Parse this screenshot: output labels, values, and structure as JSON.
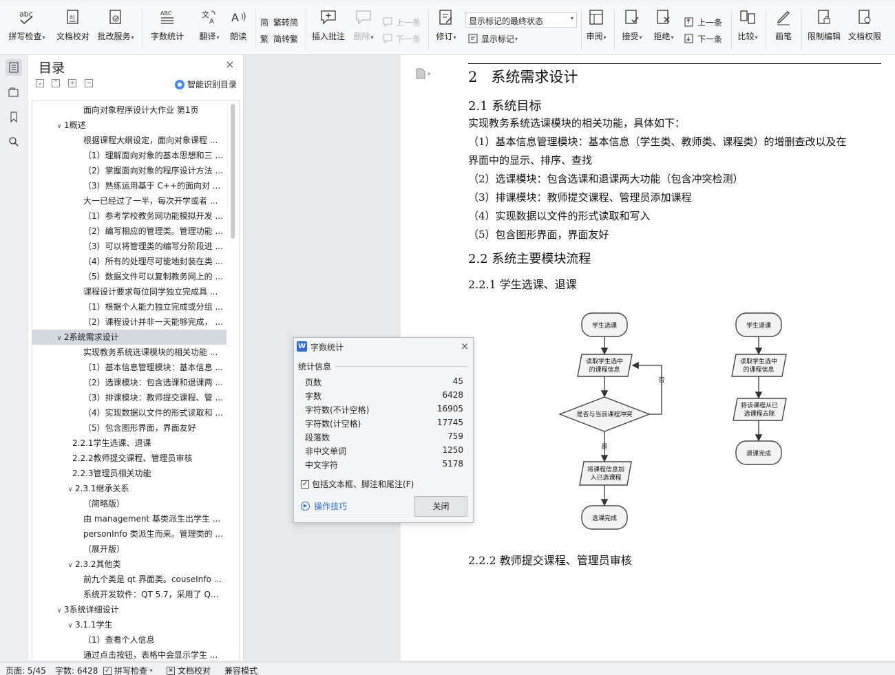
{
  "ribbon": {
    "spell_check": "拼写检查",
    "doc_proof": "文档校对",
    "batch_service": "批改服务",
    "word_count": "字数统计",
    "translate": "翻译",
    "read_aloud": "朗读",
    "trad_convert": "繁转简",
    "simp_convert": "简转繁",
    "insert_comment": "插入批注",
    "delete": "删除",
    "prev_comment": "上一条",
    "next_comment": "下一条",
    "revise": "修订",
    "markup_state": "显示标记的最终状态",
    "show_markup": "显示标记",
    "review": "审阅",
    "accept": "接受",
    "reject": "拒绝",
    "prev_change": "上一条",
    "next_change": "下一条",
    "compare": "比较",
    "pen": "画笔",
    "restrict_edit": "限制编辑",
    "doc_permission": "文档权限"
  },
  "toc": {
    "title": "目录",
    "smart_label": "智能识别目录",
    "items": [
      {
        "text": "面向对象程序设计大作业 第1页",
        "toggle": ""
      },
      {
        "text": "1概述",
        "toggle": "∨"
      },
      {
        "text": "根据课程大纲设定，面向对象课程 ...",
        "toggle": ""
      },
      {
        "text": "（1）理解面向对象的基本思想和三 ...",
        "toggle": ""
      },
      {
        "text": "（2）掌握面向对象的程序设计方法 ...",
        "toggle": ""
      },
      {
        "text": "（3）熟练运用基于 C++的面向对 ...",
        "toggle": ""
      },
      {
        "text": "大一已经过了一半，每次开学或者 ...",
        "toggle": ""
      },
      {
        "text": "（1）参考学校教务网功能模拟开发 ...",
        "toggle": ""
      },
      {
        "text": "（2）编写相应的管理类。管理功能 ...",
        "toggle": ""
      },
      {
        "text": "（3）可以将管理类的编写分阶段进 ...",
        "toggle": ""
      },
      {
        "text": "（4）所有的处理尽可能地封装在类 ...",
        "toggle": ""
      },
      {
        "text": "（5）数据文件可以复制教务网上的 ...",
        "toggle": ""
      },
      {
        "text": "课程设计要求每位同学独立完成具 ...",
        "toggle": ""
      },
      {
        "text": "（1）根据个人能力独立完成或分组 ...",
        "toggle": ""
      },
      {
        "text": "（2）课程设计并非一天能够完成， ...",
        "toggle": ""
      },
      {
        "text": "2系统需求设计",
        "toggle": "∨"
      },
      {
        "text": "实现教务系统选课模块的相关功能 ...",
        "toggle": ""
      },
      {
        "text": "（1）基本信息管理模块：基本信息 ...",
        "toggle": ""
      },
      {
        "text": "（2）选课模块：包含选课和退课两 ...",
        "toggle": ""
      },
      {
        "text": "（3）排课模块：教师提交课程、管 ...",
        "toggle": ""
      },
      {
        "text": "（4）实现数据以文件的形式读取和 ...",
        "toggle": ""
      },
      {
        "text": "（5）包含图形界面，界面友好",
        "toggle": ""
      },
      {
        "text": "2.2.1学生选课、退课",
        "toggle": ""
      },
      {
        "text": "2.2.2教师提交课程、管理员审核",
        "toggle": ""
      },
      {
        "text": "2.2.3管理员相关功能",
        "toggle": ""
      },
      {
        "text": "2.3.1继承关系",
        "toggle": "∨"
      },
      {
        "text": "（简略版）",
        "toggle": ""
      },
      {
        "text": "由 management 基类派生出学生 ...",
        "toggle": ""
      },
      {
        "text": "personInfo 类派生而来。管理类的 ...",
        "toggle": ""
      },
      {
        "text": "（展开版）",
        "toggle": ""
      },
      {
        "text": "2.3.2其他类",
        "toggle": "∨"
      },
      {
        "text": "前九个类是 qt 界面类。couseInfo ...",
        "toggle": ""
      },
      {
        "text": "系统开发软件：QT 5.7，采用了 Q...",
        "toggle": ""
      },
      {
        "text": "3系统详细设计",
        "toggle": "∨"
      },
      {
        "text": "3.1.1学生",
        "toggle": "∨"
      },
      {
        "text": "（1）查看个人信息",
        "toggle": ""
      },
      {
        "text": "通过点击按钮，表格中会显示学生 ...",
        "toggle": ""
      }
    ]
  },
  "doc": {
    "h1_num": "2",
    "h1": "系统需求设计",
    "h2_1": "2.1  系统目标",
    "p_intro": "实现教务系统选课模块的相关功能，具体如下：",
    "p1a": "（1）基本信息管理模块：基本信息（学生类、教师类、课程类）的增删查改以及在",
    "p1b": "界面中的显示、排序、查找",
    "p2": "（2）选课模块：包含选课和退课两大功能（包含冲突检测）",
    "p3": "（3）排课模块：教师提交课程、管理员添加课程",
    "p4": "（4）实现数据以文件的形式读取和写入",
    "p5": "（5）包含图形界面，界面友好",
    "h2_2": "2.2  系统主要模块流程",
    "h3_1": "2.2.1  学生选课、退课",
    "h3_2": "2.2.2  教师提交课程、管理员审核",
    "flow": {
      "select_start": "学生选课",
      "read_courses_1": "读取学生选中",
      "read_courses_2": "的课程信息",
      "conflict": "是否与当前课程冲突",
      "no": "否",
      "yes": "是",
      "add_1": "将课程信息加",
      "add_2": "入已选课程",
      "select_done": "选课完成",
      "drop_start": "学生退课",
      "drop_read_1": "读取学生选中",
      "drop_read_2": "的课程信息",
      "drop_remove_1": "将该课程从已",
      "drop_remove_2": "选课程去除",
      "drop_done": "退课完成"
    }
  },
  "dialog": {
    "title": "字数统计",
    "section": "统计信息",
    "stats": [
      {
        "label": "页数",
        "value": "45"
      },
      {
        "label": "字数",
        "value": "6428"
      },
      {
        "label": "字符数(不计空格)",
        "value": "16905"
      },
      {
        "label": "字符数(计空格)",
        "value": "17745"
      },
      {
        "label": "段落数",
        "value": "759"
      },
      {
        "label": "非中文单词",
        "value": "1250"
      },
      {
        "label": "中文字符",
        "value": "5178"
      }
    ],
    "include_label": "包括文本框、脚注和尾注(F)",
    "tips": "操作技巧",
    "close": "关闭"
  },
  "status": {
    "page": "页面: 5/45",
    "words": "字数: 6428",
    "spell": "拼写检查",
    "proof": "文档校对",
    "compat": "兼容模式"
  }
}
